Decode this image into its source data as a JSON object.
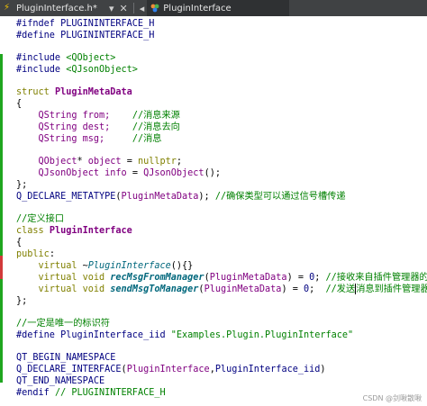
{
  "tabs": {
    "file_tab": "PluginInterface.h*",
    "symbol_tab": "PluginInterface"
  },
  "code": {
    "l1": "#ifndef PLUGININTERFACE_H",
    "l2": "#define PLUGININTERFACE_H",
    "l4a": "#include ",
    "l4b": "<QObject>",
    "l5a": "#include ",
    "l5b": "<QJsonObject>",
    "l7a": "struct ",
    "l7b": "PluginMetaData",
    "l8": "{",
    "l9a": "    QString ",
    "l9b": "from;",
    "l9c": "    //消息来源",
    "l10a": "    QString ",
    "l10b": "dest;",
    "l10c": "    //消息去向",
    "l11a": "    QString ",
    "l11b": "msg;",
    "l11c": "     //消息",
    "l13a": "    QObject",
    "l13b": "* ",
    "l13c": "object",
    "l13d": " = ",
    "l13e": "nullptr",
    "l13f": ";",
    "l14a": "    QJsonObject ",
    "l14b": "info",
    "l14c": " = ",
    "l14d": "QJsonObject",
    "l14e": "();",
    "l15": "};",
    "l16a": "Q_DECLARE_METATYPE",
    "l16b": "(",
    "l16c": "PluginMetaData",
    "l16d": "); ",
    "l16e": "//确保类型可以通过信号槽传递",
    "l18": "//定义接口",
    "l19a": "class ",
    "l19b": "PluginInterface",
    "l20": "{",
    "l21a": "public",
    "l21b": ":",
    "l22a": "    virtual ",
    "l22b": "~",
    "l22c": "PluginInterface",
    "l22d": "(){}",
    "l23a": "    virtual void ",
    "l23b": "recMsgFromManager",
    "l23c": "(",
    "l23d": "PluginMetaData",
    "l23e": ") = ",
    "l23f": "0",
    "l23g": "; ",
    "l23h": "//接收来自插件管理器的消息",
    "l24a": "    virtual void ",
    "l24b": "sendMsgToManager",
    "l24c": "(",
    "l24d": "PluginMetaData",
    "l24e": ") = ",
    "l24f": "0",
    "l24g": ";  ",
    "l24h": "//发送",
    "l24i": "消息到插件管理器",
    "l25": "};",
    "l27": "//一定是唯一的标识符",
    "l28a": "#define PluginInterface_iid ",
    "l28b": "\"Examples.Plugin.PluginInterface\"",
    "l30": "QT_BEGIN_NAMESPACE",
    "l31a": "Q_DECLARE_INTERFACE",
    "l31b": "(",
    "l31c": "PluginInterface",
    "l31d": ",",
    "l31e": "PluginInterface_iid",
    "l31f": ")",
    "l32": "QT_END_NAMESPACE",
    "l34a": "#endif ",
    "l34b": "// PLUGININTERFACE_H"
  },
  "watermark": "CSDN @剑啾散啾",
  "colors": {
    "keyword": "#808000",
    "type": "#800080",
    "function": "#00677c",
    "comment": "#008000",
    "preprocessor": "#000080",
    "modified_marker": "#1fa61f",
    "error_marker": "#d23a3a"
  }
}
